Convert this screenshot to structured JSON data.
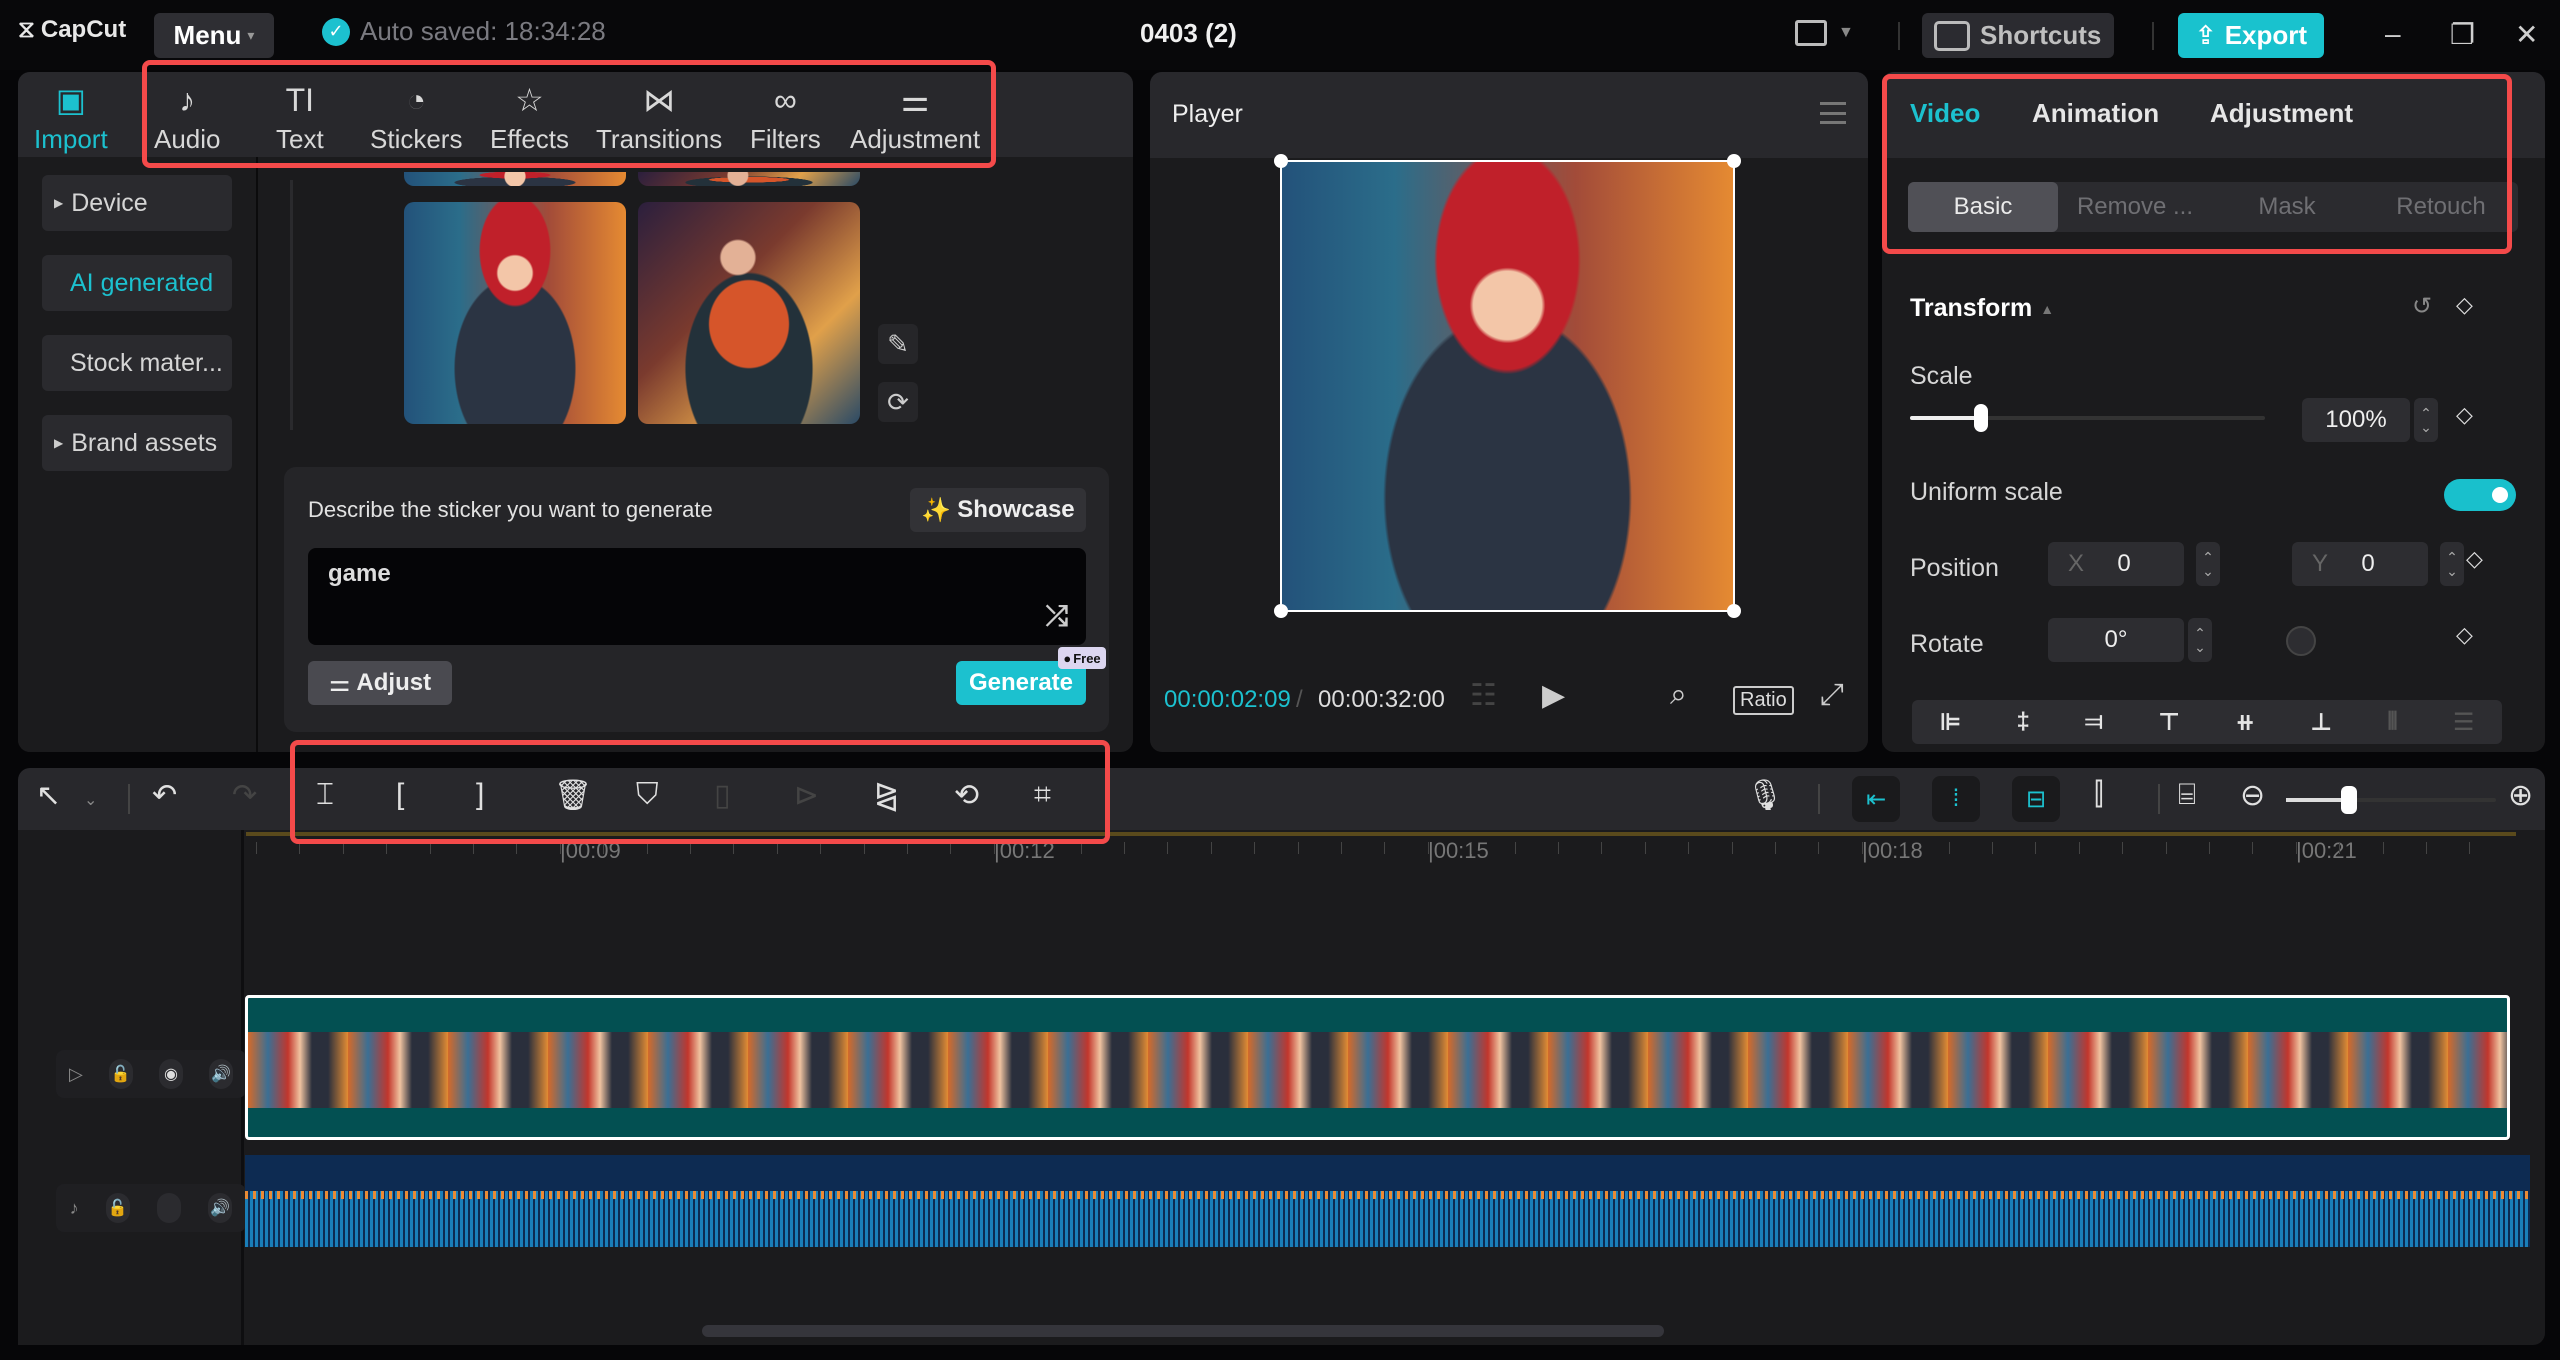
{
  "topbar": {
    "app_name": "CapCut",
    "menu_label": "Menu",
    "autosave_text": "Auto saved: 18:34:28",
    "project_title": "0403 (2)",
    "shortcuts_label": "Shortcuts",
    "export_label": "Export"
  },
  "media_tabs": [
    {
      "label": "Import",
      "icon": "import-icon",
      "active": true
    },
    {
      "label": "Audio",
      "icon": "audio-icon"
    },
    {
      "label": "Text",
      "icon": "text-icon"
    },
    {
      "label": "Stickers",
      "icon": "stickers-icon"
    },
    {
      "label": "Effects",
      "icon": "effects-icon"
    },
    {
      "label": "Transitions",
      "icon": "transitions-icon"
    },
    {
      "label": "Filters",
      "icon": "filters-icon"
    },
    {
      "label": "Adjustment",
      "icon": "adjustment-icon"
    }
  ],
  "sidebar": {
    "items": [
      {
        "label": "Device",
        "expandable": true
      },
      {
        "label": "AI generated",
        "active": true
      },
      {
        "label": "Stock mater..."
      },
      {
        "label": "Brand assets",
        "expandable": true
      }
    ]
  },
  "ai_generator": {
    "prompt_label": "Describe the sticker you want to generate",
    "showcase_label": "Showcase",
    "prompt_value": "game",
    "adjust_label": "Adjust",
    "generate_label": "Generate",
    "free_badge": "Free"
  },
  "player": {
    "title": "Player",
    "current_time": "00:00:02:09",
    "separator": "/",
    "total_time": "00:00:32:00",
    "ratio_label": "Ratio"
  },
  "inspector": {
    "tabs": [
      {
        "label": "Video",
        "active": true
      },
      {
        "label": "Animation"
      },
      {
        "label": "Adjustment"
      }
    ],
    "subtabs": [
      {
        "label": "Basic",
        "active": true
      },
      {
        "label": "Remove ..."
      },
      {
        "label": "Mask"
      },
      {
        "label": "Retouch"
      }
    ],
    "section_title": "Transform",
    "scale_label": "Scale",
    "scale_value": "100%",
    "scale_slider_fraction": 0.2,
    "uniform_scale_label": "Uniform scale",
    "uniform_scale_on": true,
    "position_label": "Position",
    "x_label": "X",
    "x_value": "0",
    "y_label": "Y",
    "y_value": "0",
    "rotate_label": "Rotate",
    "rotate_value": "0°"
  },
  "timeline": {
    "ruler_labels": [
      "00:09",
      "00:12",
      "00:15",
      "00:18",
      "00:21"
    ],
    "zoom_slider_fraction": 0.3
  },
  "colors": {
    "accent": "#1cc1cf",
    "highlight_box": "#f44a4a",
    "video_clip": "#035052",
    "audio_clip": "#0d2b52"
  }
}
